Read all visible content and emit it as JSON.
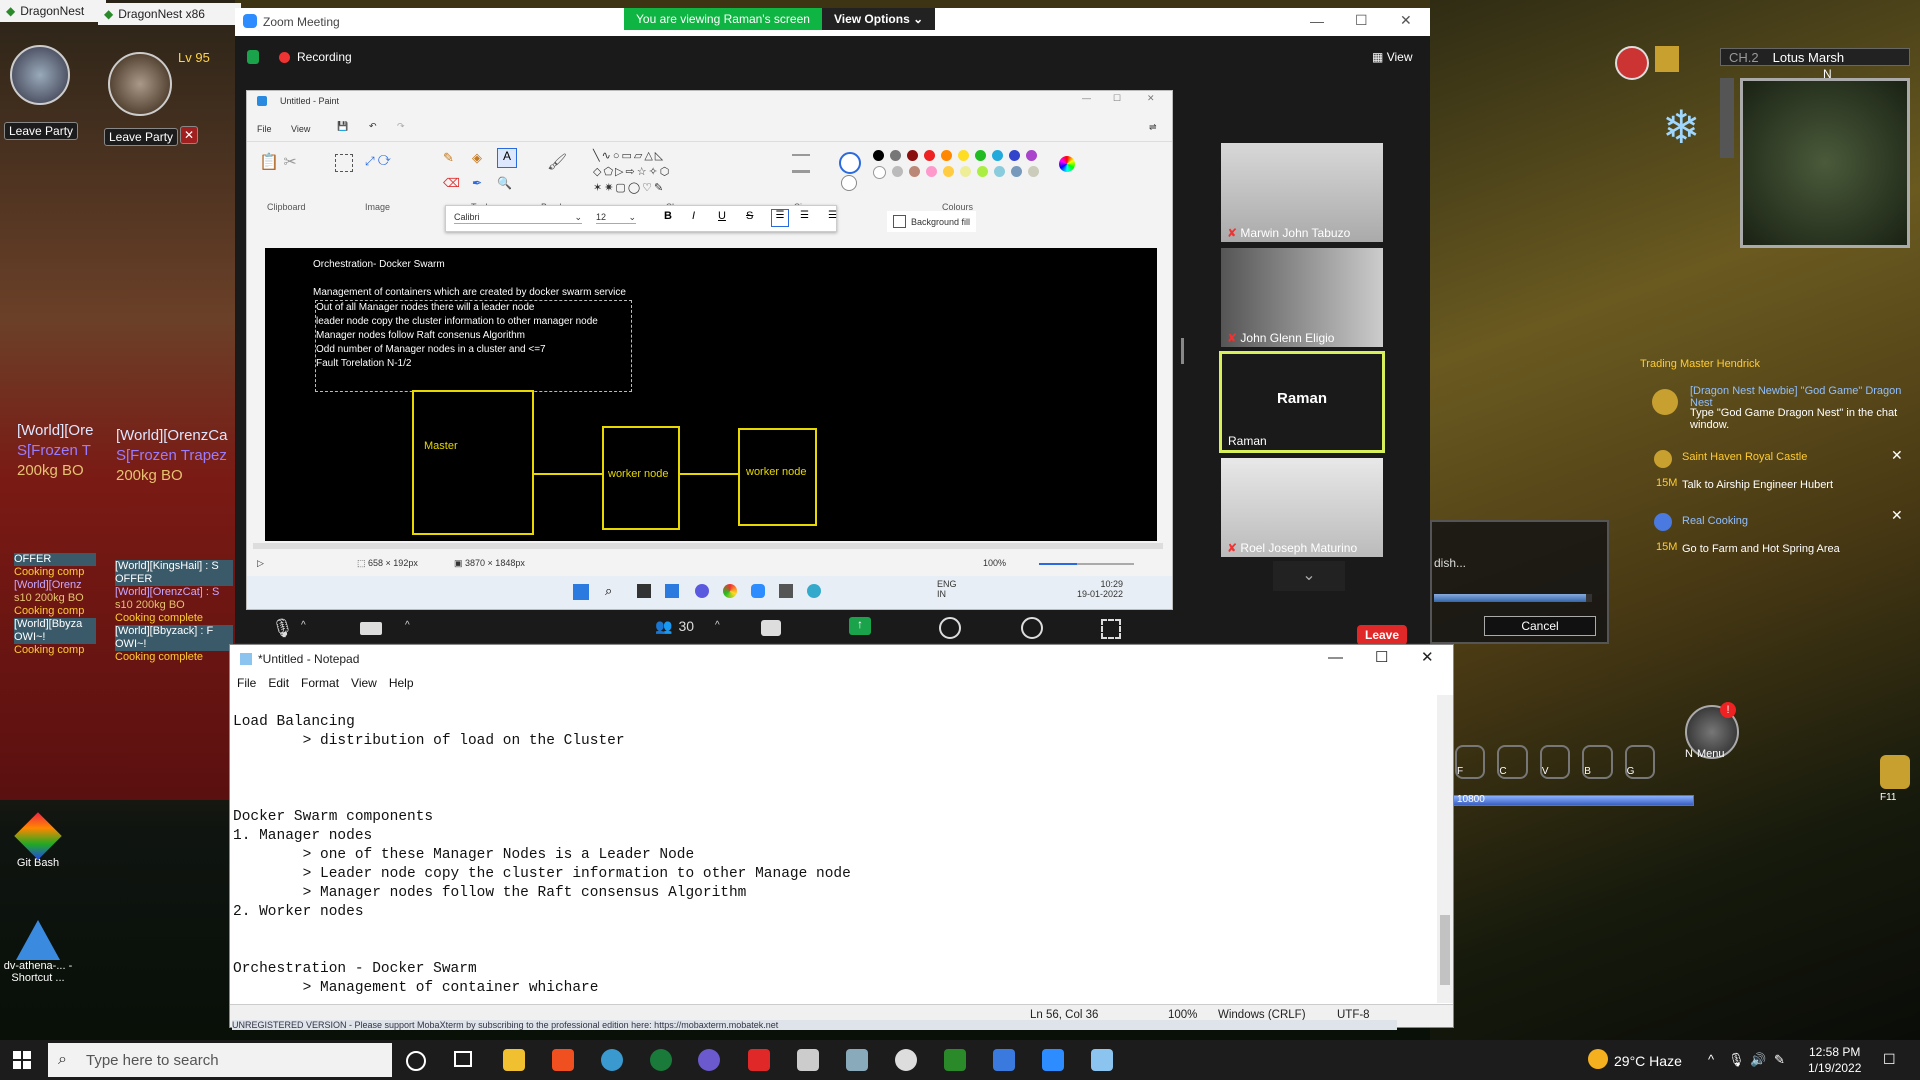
{
  "game_left": {
    "window_title_1": "DragonNest",
    "window_title_2": "DragonNest x86",
    "level": "Lv 95",
    "leave_party": "Leave Party",
    "world_1": "[World][Ore",
    "world_2": "[World][OrenzCa",
    "frozen_1": "S[Frozen T",
    "frozen_2": "S[Frozen Trapez",
    "bo_1": "200kg BO",
    "bo_2": "200kg BO",
    "chat_left": [
      "OFFER",
      "Cooking comp",
      "[World][Orenz",
      "s10 200kg BO",
      "Cooking comp",
      "[World][Bbyza",
      "OWI~!",
      "Cooking comp"
    ],
    "chat_mid": [
      "[World][KingsHail] : S",
      "OFFER",
      "[World][OrenzCat] : S",
      "s10 200kg BO",
      "Cooking complete",
      "[World][Bbyzack] : F",
      "OWI~!",
      "Cooking complete"
    ]
  },
  "desktop": {
    "icons": [
      "Git Bash",
      "dv-athena-... - Shortcut ..."
    ]
  },
  "zoom": {
    "title": "Zoom Meeting",
    "banner": "You are viewing Raman's screen",
    "view_options": "View Options",
    "recording": "Recording",
    "view": "View",
    "participants": [
      {
        "name": "Marwin John Tabuzo"
      },
      {
        "name": "John Glenn Eligio"
      },
      {
        "name": "Raman",
        "center": "Raman"
      },
      {
        "name": "Roel Joseph Maturino"
      }
    ],
    "participant_count": "30",
    "leave": "Leave"
  },
  "paint": {
    "title": "Untitled - Paint",
    "menu": [
      "File",
      "View"
    ],
    "groups": [
      "Clipboard",
      "Image",
      "Tools",
      "Brushes",
      "Shapes",
      "Size",
      "Colours"
    ],
    "font": "Calibri",
    "font_size": "12",
    "background_fill": "Background fill",
    "canvas_title": "Orchestration- Docker Swarm",
    "canvas_line": "Management of containers which are created by docker swarm service",
    "canvas_box_lines": [
      "Out of all Manager nodes there will a leader node",
      "leader node copy the cluster information to other  manager node",
      "Manager nodes follow Raft consenus Algorithm",
      "Odd number of Manager nodes in a cluster and <=7",
      "Fault Torelation N-1/2"
    ],
    "boxes": [
      "Master",
      "worker node",
      "worker node"
    ],
    "selection_size": "658 × 192px",
    "canvas_size": "3870 × 1848px",
    "zoom": "100%",
    "inner_lang": "ENG\nIN",
    "inner_time": "10:29",
    "inner_date": "19-01-2022"
  },
  "notepad": {
    "title": "*Untitled - Notepad",
    "menu": [
      "File",
      "Edit",
      "Format",
      "View",
      "Help"
    ],
    "text": "Load Balancing\n        > distribution of load on the Cluster\n\n\n\nDocker Swarm components\n1. Manager nodes\n        > one of these Manager Nodes is a Leader Node\n        > Leader node copy the cluster information to other Manage node\n        > Manager nodes follow the Raft consensus Algorithm\n2. Worker nodes\n\n\nOrchestration - Docker Swarm\n        > Management of container whichare",
    "position": "Ln 56, Col 36",
    "zoom": "100%",
    "line_ending": "Windows (CRLF)",
    "encoding": "UTF-8",
    "behind_text": "UNREGISTERED VERSION - Please support MobaXterm by subscribing to the professional edition here: https://mobaxterm.mobatek.net"
  },
  "game_right": {
    "channel": "CH.2",
    "location": "Lotus Marsh",
    "compass": "N",
    "trader": "Trading Master Hendrick",
    "quest_1_title": "[Dragon Nest Newbie] \"God Game\" Dragon Nest",
    "quest_1_text": "Type \"God Game Dragon Nest\" in the chat window.",
    "quest_2_title": "Saint Haven Royal Castle",
    "quest_2_lv": "15M",
    "quest_2_text": "Talk to Airship Engineer Hubert",
    "quest_3_title": "Real Cooking",
    "quest_3_lv": "15M",
    "quest_3_text": "Go to Farm and Hot Spring Area",
    "progress_label": "dish...",
    "cancel": "Cancel",
    "skill_keys": [
      "F",
      "C",
      "V",
      "B",
      "G"
    ],
    "menu": "Menu",
    "mp": "10800",
    "f11": "F11",
    "n_key": "N"
  },
  "taskbar": {
    "search_placeholder": "Type here to search",
    "weather": "29°C  Haze",
    "time": "12:58 PM",
    "date": "1/19/2022"
  }
}
